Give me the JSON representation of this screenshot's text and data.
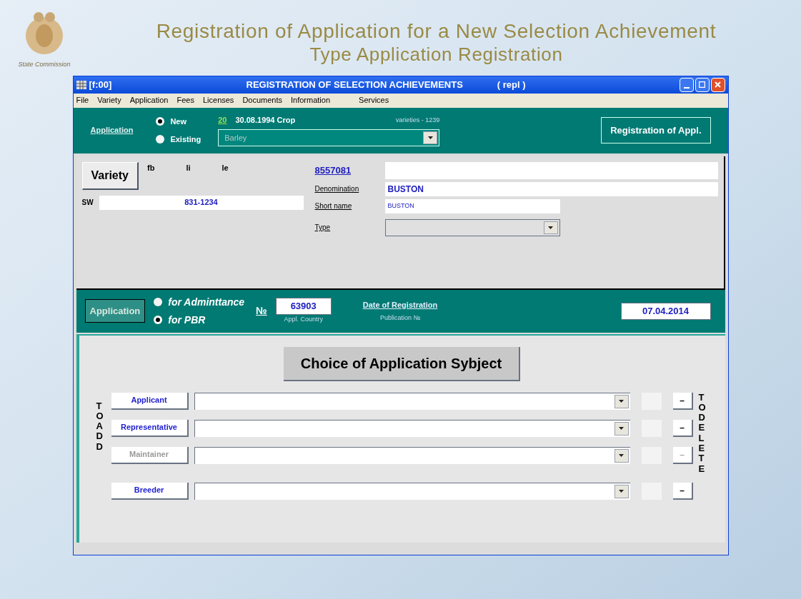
{
  "slide": {
    "title": "Registration of Application for a New Selection Achievement",
    "subtitle": "Type Application Registration",
    "emblem_caption": "State Commission"
  },
  "window": {
    "title_left": "[f:00]",
    "title": "REGISTRATION OF SELECTION ACHIEVEMENTS",
    "title_right": "( repl )"
  },
  "menu": [
    "File",
    "Variety",
    "Application",
    "Fees",
    "Licenses",
    "Documents",
    "Information",
    "Services"
  ],
  "top_bar": {
    "link": "Application",
    "radios": [
      {
        "label": "New",
        "selected": true
      },
      {
        "label": "Existing",
        "selected": false
      }
    ],
    "count": "20",
    "date_crop": "30.08.1994  Crop",
    "varieties": "varieties - 1239",
    "crop_value": "Barley",
    "register_button": "Registration of Appl."
  },
  "variety": {
    "button": "Variety",
    "codes": [
      "fb",
      "li",
      "le"
    ],
    "number": "8557081",
    "sw_label": "SW",
    "sw_value": "831-1234",
    "denomination_label": "Denomination",
    "denomination": "BUSTON",
    "short_name_label": "Short name",
    "short_name": "BUSTON",
    "type_label": "Type"
  },
  "application": {
    "button": "Application",
    "radios": [
      {
        "label": "for Adminttance",
        "selected": false
      },
      {
        "label": "for PBR",
        "selected": true
      }
    ],
    "no_label": "№",
    "number": "63903",
    "country_label": "Appl. Country",
    "date_label": "Date of Registration",
    "date": "07.04.2014",
    "publication_label": "Publication  №"
  },
  "subjects": {
    "title": "Choice of Application Sybject",
    "add_label": "TO ADD",
    "delete_label": "TO DELETE",
    "rows": [
      {
        "label": "Applicant",
        "disabled": false,
        "delete": "–"
      },
      {
        "label": "Representative",
        "disabled": false,
        "delete": "–"
      },
      {
        "label": "Maintainer",
        "disabled": true,
        "delete": "–"
      },
      {
        "label": "Breeder",
        "disabled": false,
        "delete": "–"
      }
    ]
  }
}
